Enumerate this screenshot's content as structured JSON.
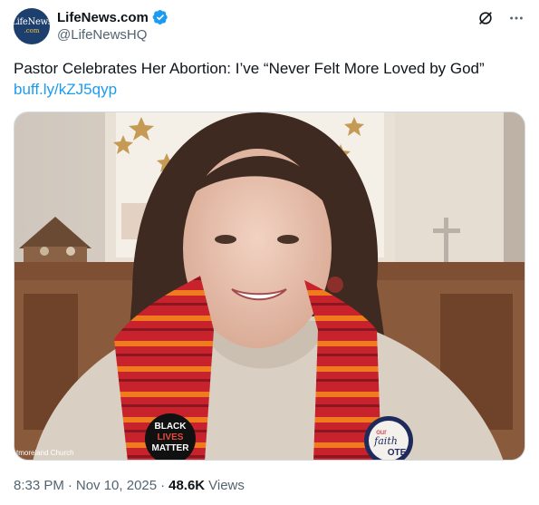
{
  "account": {
    "display_name": "LifeNews.com",
    "handle": "@LifeNewsHQ",
    "avatar_line1": "LifeNews",
    "avatar_line2": ".com"
  },
  "tweet": {
    "text": "Pastor Celebrates Her Abortion: I’ve “Never Felt More Loved by God”",
    "link": "buff.ly/kZJ5qyp"
  },
  "media": {
    "watermark": "tmoreland Church",
    "button_left_lines": [
      "BLACK",
      "LIVES",
      "MATTER"
    ],
    "button_right_line1": "our",
    "button_right_line2": "faith",
    "button_right_line3": "OTE"
  },
  "footer": {
    "time": "8:33 PM",
    "separator": "·",
    "date": "Nov 10, 2025",
    "views_count": "48.6K",
    "views_label": "Views"
  },
  "colors": {
    "accent_link": "#1d9bf0",
    "verified": "#1d9bf0",
    "secondary_text": "#536471"
  },
  "icons": [
    "verified-badge-icon",
    "grok-icon",
    "more-icon"
  ]
}
